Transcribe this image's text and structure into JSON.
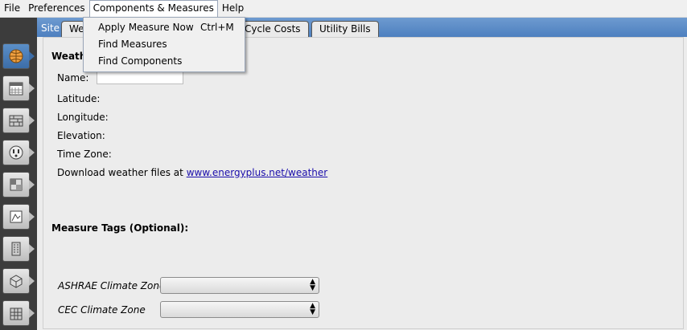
{
  "menubar": {
    "items": [
      "File",
      "Preferences",
      "Components & Measures",
      "Help"
    ]
  },
  "dropdown": {
    "items": [
      {
        "label": "Apply Measure Now",
        "shortcut": "Ctrl+M"
      },
      {
        "label": "Find Measures",
        "shortcut": ""
      },
      {
        "label": "Find Components",
        "shortcut": ""
      }
    ]
  },
  "tabs": {
    "site_label": "Site",
    "items": [
      "We",
      "Cycle Costs",
      "Utility Bills"
    ]
  },
  "sidebar": {
    "icons": [
      "globe-icon",
      "calendar-icon",
      "constructions-icon",
      "outlet-icon",
      "spacetypes-icon",
      "drawing-icon",
      "building-icon",
      "geometry-icon",
      "facility-icon"
    ]
  },
  "weather": {
    "heading": "Weath",
    "name_label": "Name:",
    "name_value": "",
    "latitude_label": "Latitude:",
    "longitude_label": "Longitude:",
    "elevation_label": "Elevation:",
    "timezone_label": "Time Zone:",
    "download_text": "Download weather files at",
    "download_link": "www.energyplus.net/weather"
  },
  "measure_tags": {
    "heading": "Measure Tags (Optional):",
    "ashrae_label": "ASHRAE Climate Zone",
    "ashrae_value": "",
    "cec_label": "CEC Climate Zone",
    "cec_value": ""
  }
}
